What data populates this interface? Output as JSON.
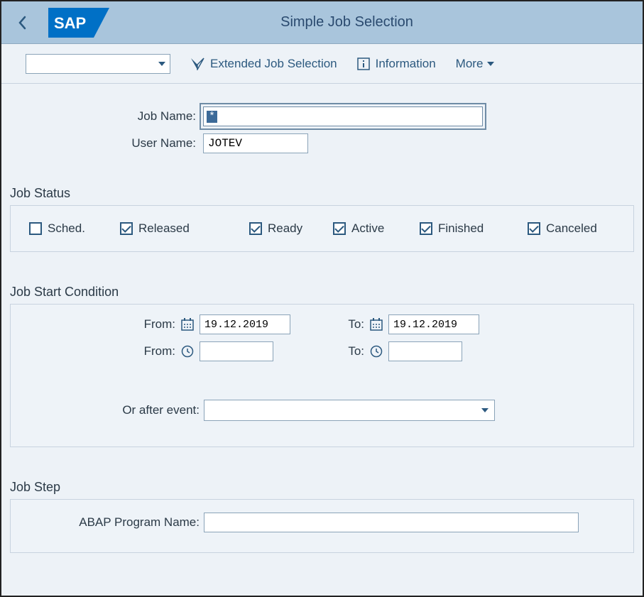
{
  "header": {
    "title": "Simple Job Selection",
    "logo_text": "SAP"
  },
  "toolbar": {
    "dropdown_value": "",
    "extended_label": "Extended Job Selection",
    "information_label": "Information",
    "more_label": "More"
  },
  "form": {
    "job_name_label": "Job Name:",
    "job_name_value": "*",
    "user_name_label": "User Name:",
    "user_name_value": "JOTEV"
  },
  "job_status": {
    "title": "Job Status",
    "items": [
      {
        "label": "Sched.",
        "checked": false
      },
      {
        "label": "Released",
        "checked": true
      },
      {
        "label": "Ready",
        "checked": true
      },
      {
        "label": "Active",
        "checked": true
      },
      {
        "label": "Finished",
        "checked": true
      },
      {
        "label": "Canceled",
        "checked": true
      }
    ]
  },
  "job_start": {
    "title": "Job Start Condition",
    "from_label": "From:",
    "to_label": "To:",
    "date_from": "19.12.2019",
    "date_to": "19.12.2019",
    "time_from": "",
    "time_to": "",
    "or_after_event_label": "Or after event:",
    "event_value": ""
  },
  "job_step": {
    "title": "Job Step",
    "abap_label": "ABAP Program Name:",
    "abap_value": ""
  }
}
